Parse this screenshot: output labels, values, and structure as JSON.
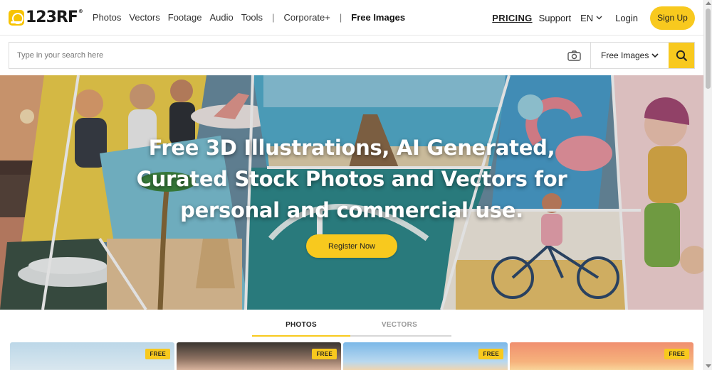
{
  "brand": {
    "name": "123RF",
    "mark": "®"
  },
  "nav": {
    "items": [
      "Photos",
      "Vectors",
      "Footage",
      "Audio",
      "Tools"
    ],
    "separator": "|",
    "corporate": "Corporate+",
    "free_images": "Free Images"
  },
  "right_nav": {
    "pricing": "PRICING",
    "support": "Support",
    "language": "EN",
    "login": "Login",
    "signup": "Sign Up"
  },
  "search": {
    "placeholder": "Type in your search here",
    "value": "",
    "type_selected": "Free Images"
  },
  "hero": {
    "headline_lines": [
      "Free 3D Illustrations, AI Generated,",
      "Curated Stock Photos and Vectors for",
      "personal and commercial use."
    ],
    "cta": "Register Now"
  },
  "tabs": [
    {
      "label": "PHOTOS",
      "active": true
    },
    {
      "label": "VECTORS",
      "active": false
    }
  ],
  "thumbnails": [
    {
      "badge": "FREE"
    },
    {
      "badge": "FREE"
    },
    {
      "badge": "FREE"
    },
    {
      "badge": "FREE"
    }
  ],
  "icons": {
    "camera": "camera-icon",
    "search": "search-icon",
    "chevron": "chevron-down-icon"
  },
  "colors": {
    "accent": "#f8c91e",
    "text": "#222222",
    "border": "#dcdcdc"
  }
}
